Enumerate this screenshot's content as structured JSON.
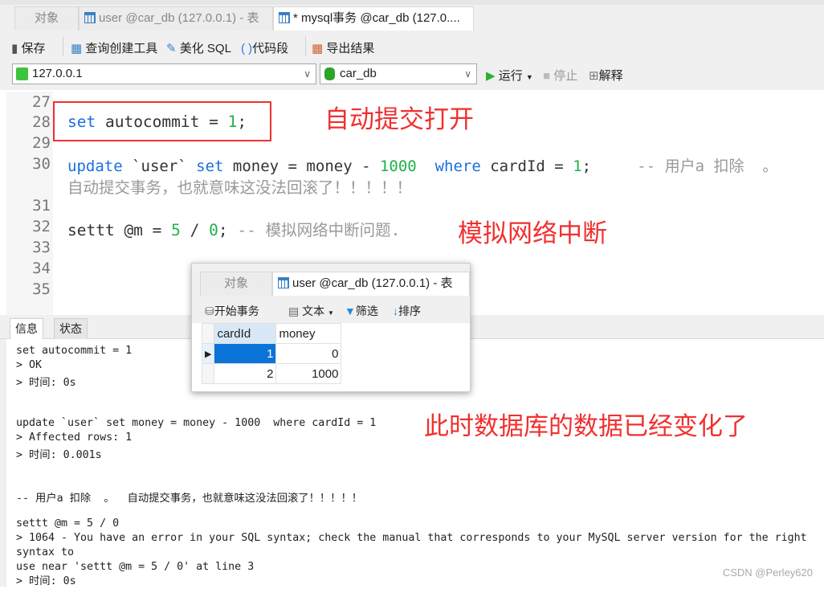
{
  "tabs": [
    {
      "label": "对象"
    },
    {
      "label": "user @car_db (127.0.0.1) - 表"
    },
    {
      "label": "* mysql事务 @car_db (127.0...."
    }
  ],
  "toolbar": {
    "save": "保存",
    "query_builder": "查询创建工具",
    "beautify": "美化 SQL",
    "snippet": "代码段",
    "export": "导出结果"
  },
  "connection": {
    "host": "127.0.0.1",
    "database": "car_db",
    "run": "运行",
    "stop": "停止",
    "explain": "解释"
  },
  "editor": {
    "line_numbers": [
      "27",
      "28",
      "29",
      "30",
      "31",
      "32",
      "33",
      "34",
      "35"
    ],
    "line28": {
      "kw": "set",
      "text": " autocommit = ",
      "num": "1",
      "end": ";"
    },
    "line30": {
      "kw1": "update",
      "t1": " `user` ",
      "kw2": "set",
      "t2": " money = money - ",
      "num1": "1000",
      "kw3": "  where",
      "t3": " cardId = ",
      "num2": "1",
      "t4": ";",
      "comment": "     -- 用户a 扣除  。",
      "comment_wrap": "自动提交事务，也就意味这没法回滚了！！！！！"
    },
    "line32": {
      "t1": "settt @m = ",
      "n1": "5",
      "t2": " / ",
      "n2": "0",
      "t3": "; ",
      "comment": "-- 模拟网络中断问题."
    }
  },
  "annotations": {
    "autocommit": "自动提交打开",
    "network": "模拟网络中断",
    "changed": "此时数据库的数据已经变化了"
  },
  "bottom_tabs": {
    "info": "信息",
    "status": "状态"
  },
  "output": [
    "set autocommit = 1",
    "> OK",
    "> 时间: 0s",
    "update `user` set money = money - 1000  where cardId = 1",
    "> Affected rows: 1",
    "> 时间: 0.001s",
    "-- 用户a 扣除  。  自动提交事务，也就意味这没法回滚了！！！！！",
    "settt @m = 5 / 0",
    "> 1064 - You have an error in your SQL syntax; check the manual that corresponds to your MySQL server version for the right syntax to",
    "use near 'settt @m = 5 / 0' at line 3",
    "> 时间: 0s"
  ],
  "popup": {
    "tabs": [
      "对象",
      "user @car_db (127.0.0.1) - 表"
    ],
    "toolbar": {
      "begin": "开始事务",
      "text": "文本",
      "filter": "筛选",
      "sort": "排序"
    },
    "columns": [
      "cardId",
      "money"
    ],
    "rows": [
      [
        "1",
        "0"
      ],
      [
        "2",
        "1000"
      ]
    ]
  },
  "watermark": "CSDN @Perley620"
}
